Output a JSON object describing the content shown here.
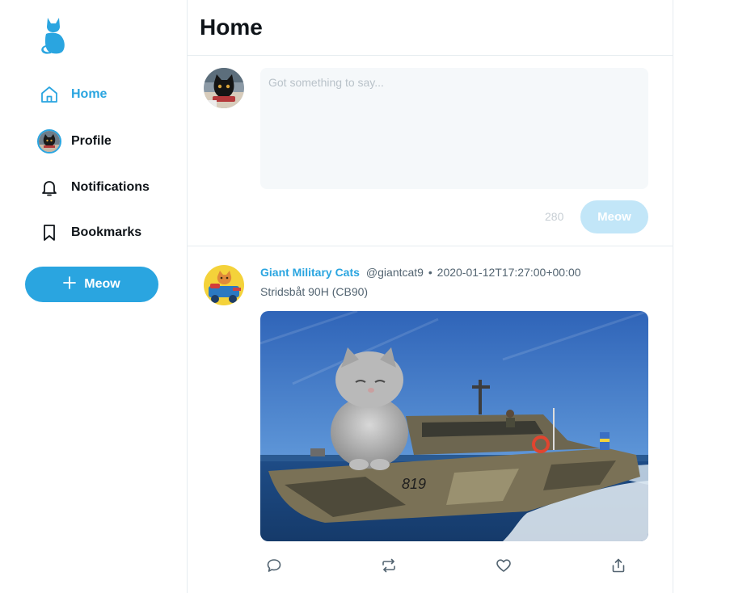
{
  "sidebar": {
    "logo_icon": "cat-logo-icon",
    "nav": [
      {
        "label": "Home",
        "icon": "home-icon",
        "active": true
      },
      {
        "label": "Profile",
        "icon": "avatar"
      },
      {
        "label": "Notifications",
        "icon": "bell-icon"
      },
      {
        "label": "Bookmarks",
        "icon": "bookmark-icon"
      }
    ],
    "meow_button": {
      "label": "Meow",
      "icon": "plus-icon"
    }
  },
  "header": {
    "title": "Home"
  },
  "composer": {
    "placeholder": "Got something to say...",
    "char_count": "280",
    "submit_label": "Meow"
  },
  "feed": [
    {
      "author_name": "Giant Military Cats",
      "handle": "@giantcat9",
      "timestamp": "2020-01-12T17:27:00+00:00",
      "text": "Stridsbåt 90H (CB90)",
      "media": "photo of a giant kitten riding a camouflaged military boat (819) on the sea",
      "actions": [
        "reply-icon",
        "retweet-icon",
        "like-icon",
        "share-icon"
      ]
    }
  ],
  "colors": {
    "accent": "#2aa5e0",
    "accent_disabled": "#c2e6f8",
    "border": "#e6ecf0",
    "textarea_bg": "#f5f8fa",
    "muted_text": "#536471"
  }
}
